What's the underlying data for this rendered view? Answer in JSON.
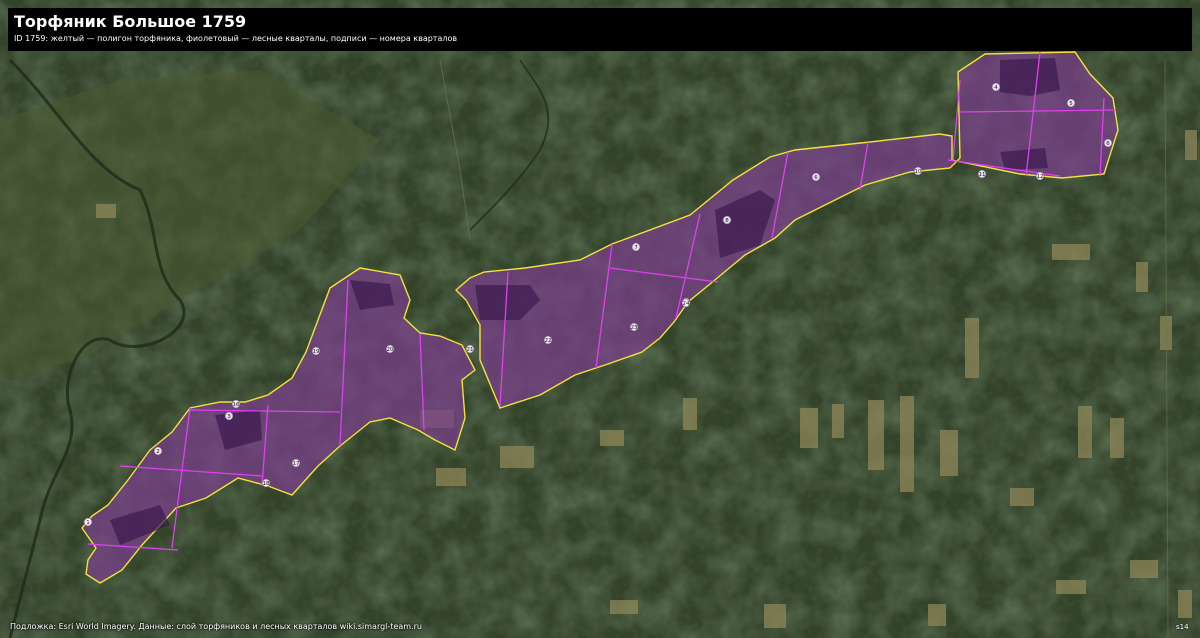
{
  "header": {
    "title": "Торфяник Большое 1759",
    "subtitle": "ID 1759: желтый — полигон торфяника, фиолетовый — лесные кварталы, подписи — номера кварталов"
  },
  "footer": {
    "attribution": "Подложка: Esri World Imagery. Данные: слой торфяников и лесных кварталов wiki.simargl-team.ru",
    "corner_label": "s14"
  },
  "map": {
    "basemap": "satellite imagery",
    "colors": {
      "peatland_outline": "#f2e23a",
      "peatland_fill": "#7a3f8c",
      "quarter_lines": "#e040f0",
      "label_marker_fill": "#ffffff",
      "label_marker_stroke": "#7a3f8c",
      "forest_dark": "#24321e",
      "forest_mid": "#3b4d2c",
      "field_light": "#9a8f63",
      "title_bar": "#000000"
    },
    "quarter_labels": [
      "1",
      "2",
      "3",
      "4",
      "5",
      "6",
      "6",
      "7",
      "8",
      "10",
      "11",
      "12",
      "12",
      "16",
      "17",
      "18",
      "19",
      "20",
      "21",
      "22",
      "23",
      "24"
    ]
  }
}
